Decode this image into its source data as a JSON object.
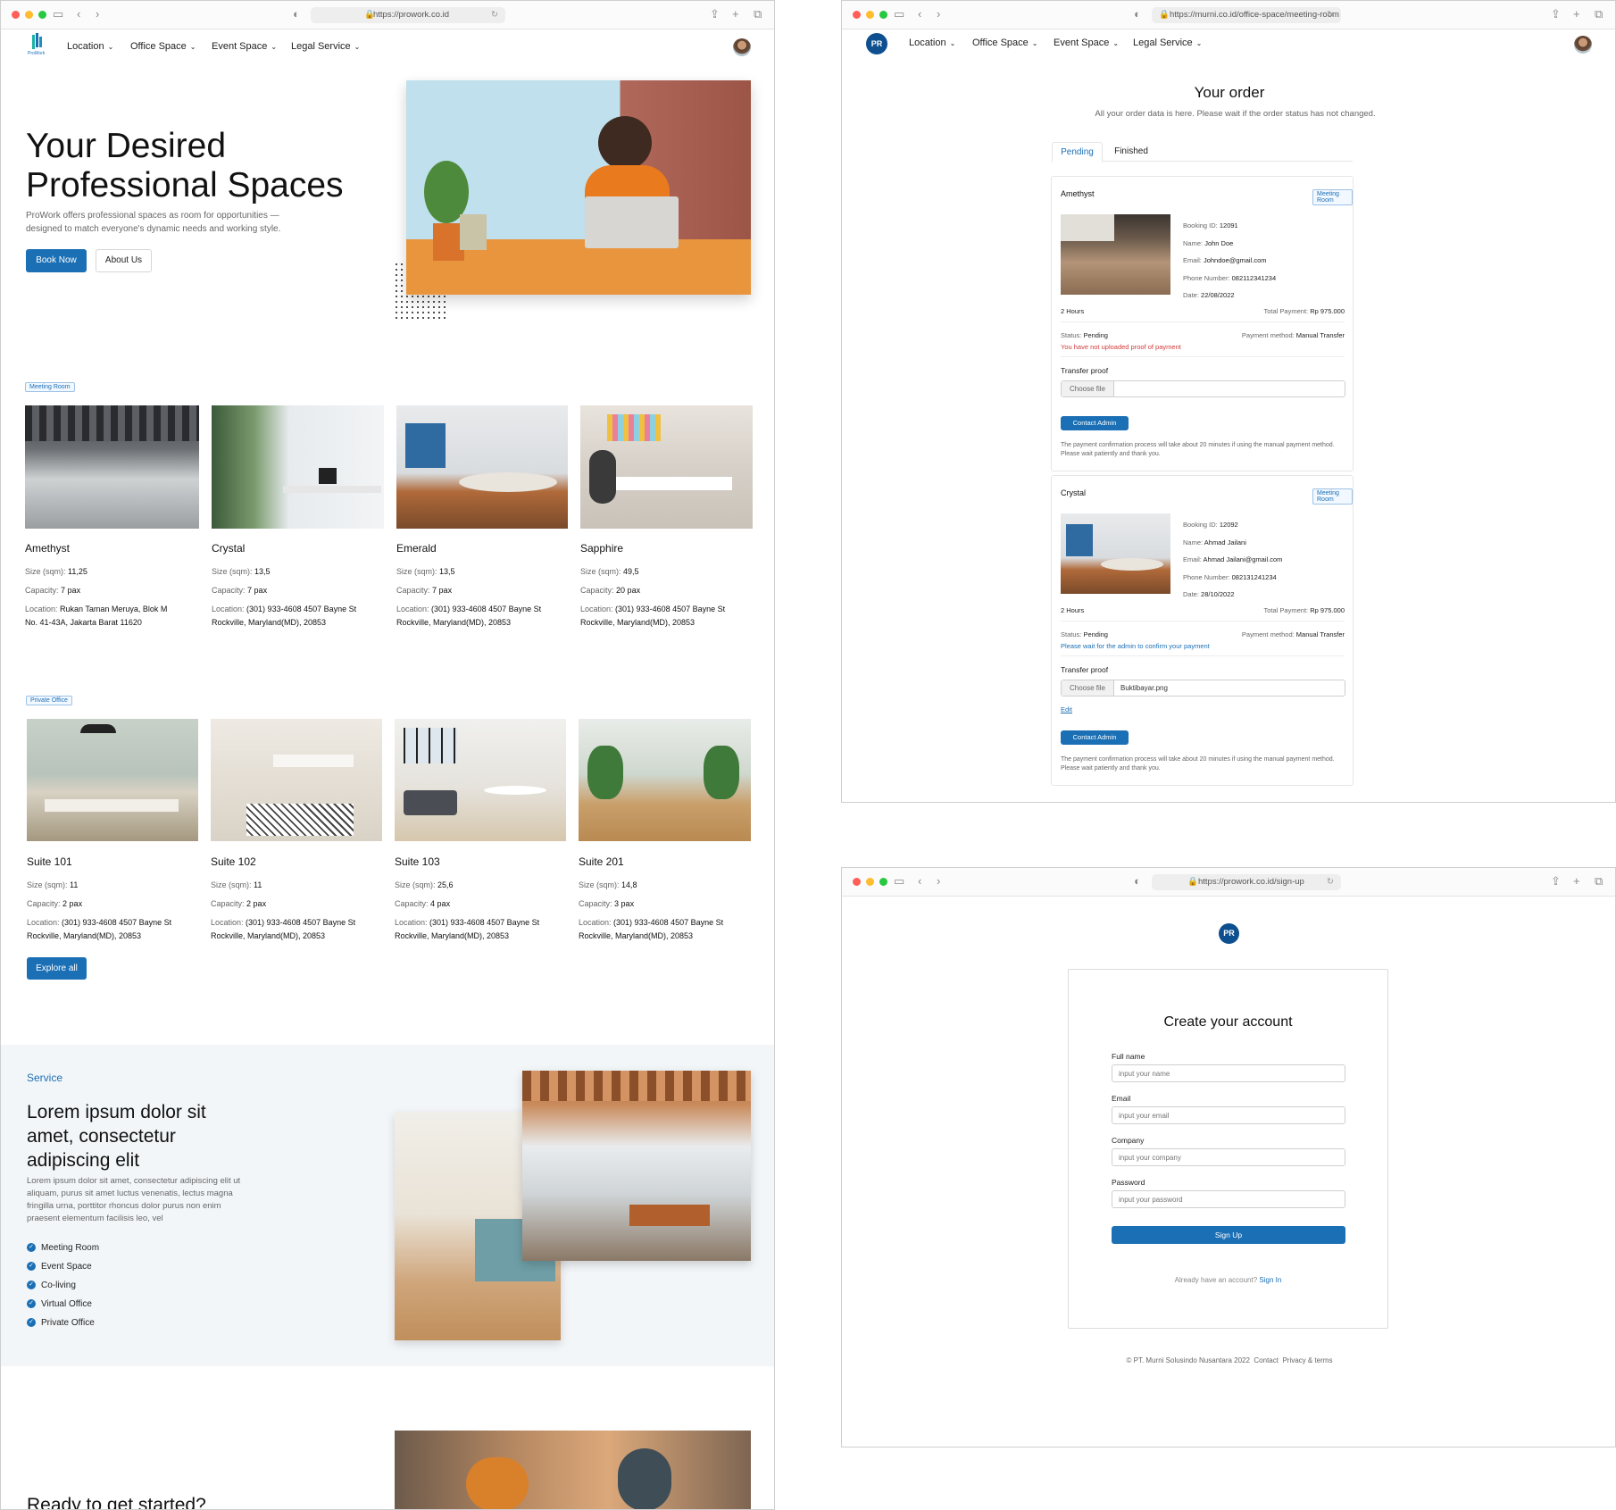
{
  "colors": {
    "primary": "#1b6fb5",
    "navy": "#0d4f8f",
    "danger": "#d23b3b",
    "bg_section": "#f3f6f9"
  },
  "landing": {
    "url": "https://prowork.co.id",
    "logo_text": "ProWork",
    "nav": [
      "Location",
      "Office Space",
      "Event Space",
      "Legal Service"
    ],
    "hero": {
      "title_line1": "Your Desired",
      "title_line2": "Professional Spaces",
      "subtitle_line1": "ProWork offers professional spaces as room for opportunities —",
      "subtitle_line2": "designed to match everyone's dynamic needs and working style.",
      "book_now": "Book Now",
      "about_us": "About Us"
    },
    "meeting_room": {
      "tag": "Meeting Room",
      "size_label": "Size (sqm):",
      "capacity_label": "Capacity:",
      "location_label": "Location:",
      "rooms": [
        {
          "name": "Amethyst",
          "size": "11,25",
          "capacity": "7 pax",
          "location_l1": "Rukan Taman Meruya, Blok M",
          "location_l2": "No. 41-43A, Jakarta Barat 11620"
        },
        {
          "name": "Crystal",
          "size": "13,5",
          "capacity": "7 pax",
          "location_l1": "(301) 933-4608 4507 Bayne St",
          "location_l2": "Rockville, Maryland(MD), 20853"
        },
        {
          "name": "Emerald",
          "size": "13,5",
          "capacity": "7 pax",
          "location_l1": "(301) 933-4608 4507 Bayne St",
          "location_l2": "Rockville, Maryland(MD), 20853"
        },
        {
          "name": "Sapphire",
          "size": "49,5",
          "capacity": "20 pax",
          "location_l1": "(301) 933-4608 4507 Bayne St",
          "location_l2": "Rockville, Maryland(MD), 20853"
        }
      ]
    },
    "private_office": {
      "tag": "Private Office",
      "rooms": [
        {
          "name": "Suite 101",
          "size": "11",
          "capacity": "2 pax",
          "location_l1": "(301) 933-4608 4507 Bayne St",
          "location_l2": "Rockville, Maryland(MD), 20853"
        },
        {
          "name": "Suite 102",
          "size": "11",
          "capacity": "2 pax",
          "location_l1": "(301) 933-4608 4507 Bayne St",
          "location_l2": "Rockville, Maryland(MD), 20853"
        },
        {
          "name": "Suite 103",
          "size": "25,6",
          "capacity": "4 pax",
          "location_l1": "(301) 933-4608 4507 Bayne St",
          "location_l2": "Rockville, Maryland(MD), 20853"
        },
        {
          "name": "Suite 201",
          "size": "14,8",
          "capacity": "3 pax",
          "location_l1": "(301) 933-4608 4507 Bayne St",
          "location_l2": "Rockville, Maryland(MD), 20853"
        }
      ],
      "explore_all": "Explore all"
    },
    "service": {
      "eyebrow": "Service",
      "title_l1": "Lorem ipsum dolor sit",
      "title_l2": "amet, consectetur",
      "title_l3": "adipiscing elit",
      "body_l1": "Lorem ipsum dolor sit amet, consectetur adipiscing elit ut",
      "body_l2": "aliquam, purus sit amet luctus venenatis, lectus magna",
      "body_l3": "fringilla urna, porttitor rhoncus dolor purus non enim",
      "body_l4": "praesent elementum facilisis leo, vel",
      "list": [
        "Meeting Room",
        "Event Space",
        "Co-living",
        "Virtual Office",
        "Private Office"
      ]
    },
    "ready_title": "Ready to get started?"
  },
  "order": {
    "url": "https://murni.co.id/office-space/meeting-room",
    "logo": "PR",
    "nav": [
      "Location",
      "Office Space",
      "Event Space",
      "Legal Service"
    ],
    "title": "Your order",
    "subtitle": "All your order data is here. Please wait if the order status has not changed.",
    "tabs": [
      "Pending",
      "Finished"
    ],
    "labels": {
      "booking_id": "Booking ID:",
      "name": "Name:",
      "email": "Email:",
      "phone": "Phone Number:",
      "date": "Date:",
      "total": "Total Payment:",
      "status": "Status:",
      "method": "Payment method:",
      "transfer_proof": "Transfer proof",
      "choose_file": "Choose file",
      "contact_admin": "Contact Admin",
      "note_l1": "The payment confirmation process will take about 20 minutes if using the manual payment method.",
      "note_l2": "Please wait patiently and thank you."
    },
    "orders": [
      {
        "room": "Amethyst",
        "tag": "Meeting Room",
        "booking_id": "12091",
        "name": "John Doe",
        "email": "Johndoe@gmail.com",
        "phone": "082112341234",
        "date": "22/08/2022",
        "duration": "2 Hours",
        "total": "Rp 975.000",
        "status": "Pending",
        "method": "Manual Transfer",
        "message": "You have not uploaded proof of payment",
        "file": ""
      },
      {
        "room": "Crystal",
        "tag": "Meeting Room",
        "booking_id": "12092",
        "name": "Ahmad Jailani",
        "email": "Ahmad Jailani@gmail.com",
        "phone": "082131241234",
        "date": "28/10/2022",
        "duration": "2 Hours",
        "total": "Rp 975.000",
        "status": "Pending",
        "method": "Manual Transfer",
        "message": "Please wait for the admin to confirm your payment",
        "file": "Buktibayar.png",
        "edit": "Edit"
      }
    ]
  },
  "signup": {
    "url": "https://prowork.co.id/sign-up",
    "logo": "PR",
    "title": "Create your account",
    "fields": [
      {
        "label": "Full name",
        "placeholder": "input your name"
      },
      {
        "label": "Email",
        "placeholder": "input your email"
      },
      {
        "label": "Company",
        "placeholder": "input your company"
      },
      {
        "label": "Password",
        "placeholder": "input your password"
      }
    ],
    "submit": "Sign Up",
    "already": "Already have an account?",
    "signin": "Sign In",
    "footer": [
      "© PT. Murni Solusindo Nusantara 2022",
      "Contact",
      "Privacy & terms"
    ]
  }
}
